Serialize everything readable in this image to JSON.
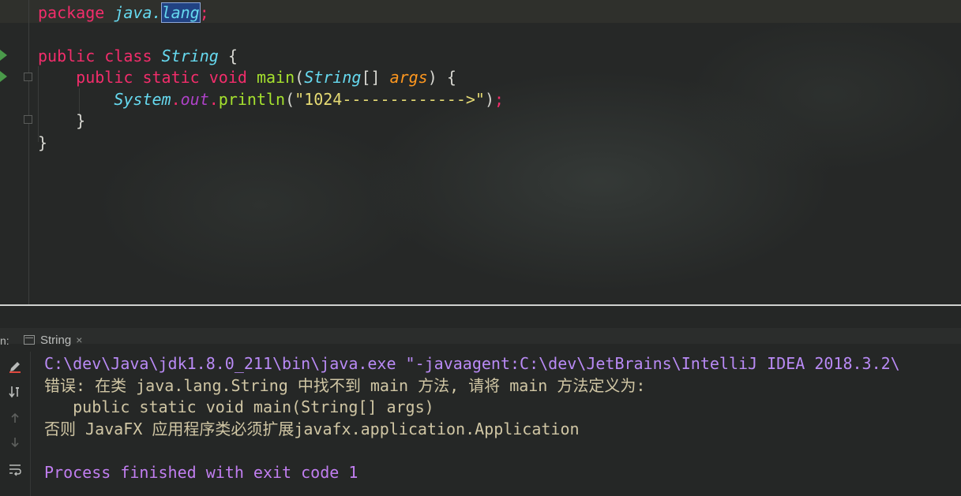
{
  "editor": {
    "lines": [
      [
        {
          "t": "package ",
          "c": "kw"
        },
        {
          "t": "java.",
          "c": "ty"
        },
        {
          "t": "lang",
          "c": "ty caret-sel"
        },
        {
          "t": ";",
          "c": "kw"
        }
      ],
      [],
      [
        {
          "t": "public ",
          "c": "kw"
        },
        {
          "t": "class ",
          "c": "kw"
        },
        {
          "t": "String",
          "c": "ty"
        },
        {
          "t": " {",
          "c": "pl"
        }
      ],
      [
        {
          "t": "    public ",
          "c": "kw"
        },
        {
          "t": "static ",
          "c": "kw"
        },
        {
          "t": "void ",
          "c": "kw"
        },
        {
          "t": "main",
          "c": "fn"
        },
        {
          "t": "(",
          "c": "pl"
        },
        {
          "t": "String",
          "c": "ty"
        },
        {
          "t": "[] ",
          "c": "pl"
        },
        {
          "t": "args",
          "c": "pa"
        },
        {
          "t": ") {",
          "c": "pl"
        }
      ],
      [
        {
          "t": "        System",
          "c": "ty"
        },
        {
          "t": ".",
          "c": "kw"
        },
        {
          "t": "out",
          "c": "fi"
        },
        {
          "t": ".",
          "c": "kw"
        },
        {
          "t": "println",
          "c": "fn"
        },
        {
          "t": "(",
          "c": "pl"
        },
        {
          "t": "\"1024------------->\"",
          "c": "st"
        },
        {
          "t": ")",
          "c": "pl"
        },
        {
          "t": ";",
          "c": "kw"
        }
      ],
      [
        {
          "t": "    }",
          "c": "pl"
        }
      ],
      [
        {
          "t": "}",
          "c": "pl"
        }
      ]
    ]
  },
  "run_panel": {
    "prefix": "n:",
    "tab_label": "String",
    "tab_close": "×",
    "toolbar_icons": [
      "pencil-icon",
      "sort-down-icon",
      "arrow-up-icon",
      "arrow-down-icon",
      "soft-wrap-icon"
    ],
    "console": {
      "command": "C:\\dev\\Java\\jdk1.8.0_211\\bin\\java.exe \"-javaagent:C:\\dev\\JetBrains\\IntelliJ IDEA 2018.3.2\\",
      "error_line1": "错误: 在类 java.lang.String 中找不到 main 方法, 请将 main 方法定义为:",
      "error_line2": "   public static void main(String[] args)",
      "error_line3": "否则 JavaFX 应用程序类必须扩展javafx.application.Application",
      "process_line": "Process finished with exit code 1"
    }
  },
  "colors": {
    "keyword": "#f22d6b",
    "type": "#66d9ef",
    "function": "#a6e22e",
    "string": "#e6db74",
    "console_command": "#b98af5",
    "console_error": "#d0c6a4",
    "console_process": "#c17ef0"
  }
}
